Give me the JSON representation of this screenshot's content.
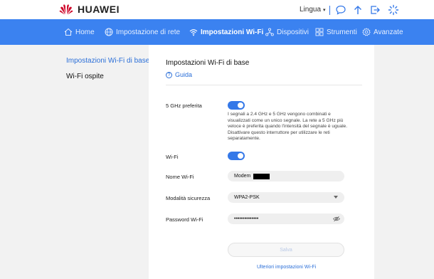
{
  "brand": {
    "name": "HUAWEI",
    "color": "#cf0a2c"
  },
  "header": {
    "language": "Lingua"
  },
  "nav": {
    "items": [
      {
        "label": "Home",
        "icon": "home-icon"
      },
      {
        "label": "Impostazione di rete",
        "icon": "globe-icon"
      },
      {
        "label": "Impostazioni Wi-Fi",
        "icon": "wifi-icon",
        "active": true
      },
      {
        "label": "Dispositivi",
        "icon": "devices-icon"
      },
      {
        "label": "Strumenti",
        "icon": "tools-icon"
      },
      {
        "label": "Avanzate",
        "icon": "gear-icon"
      }
    ],
    "accent": "#3b82f0"
  },
  "sidebar": {
    "items": [
      {
        "label": "Impostazioni Wi-Fi di base",
        "active": true
      },
      {
        "label": "Wi-Fi ospite"
      }
    ]
  },
  "main": {
    "title": "Impostazioni Wi-Fi di base",
    "help": "Guida",
    "five_ghz": {
      "label": "5 GHz preferita",
      "enabled": true,
      "description": "I segnali a 2.4 GHz e 5 GHz vengono combinati e visualizzati come un unico segnale. La rete a 5 GHz più veloce è preferita quando l'intensità del segnale è uguale. Disattivare questo interruttore per utilizzare le reti separatamente."
    },
    "wifi": {
      "label": "Wi-Fi",
      "enabled": true
    },
    "ssid": {
      "label": "Nome Wi-Fi",
      "value": "Modem"
    },
    "security": {
      "label": "Modalità sicurezza",
      "value": "WPA2-PSK"
    },
    "password": {
      "label": "Password Wi-Fi",
      "value": "••••••••••••••"
    },
    "save": "Salva",
    "more": "Ulteriori impostazioni Wi-Fi"
  }
}
